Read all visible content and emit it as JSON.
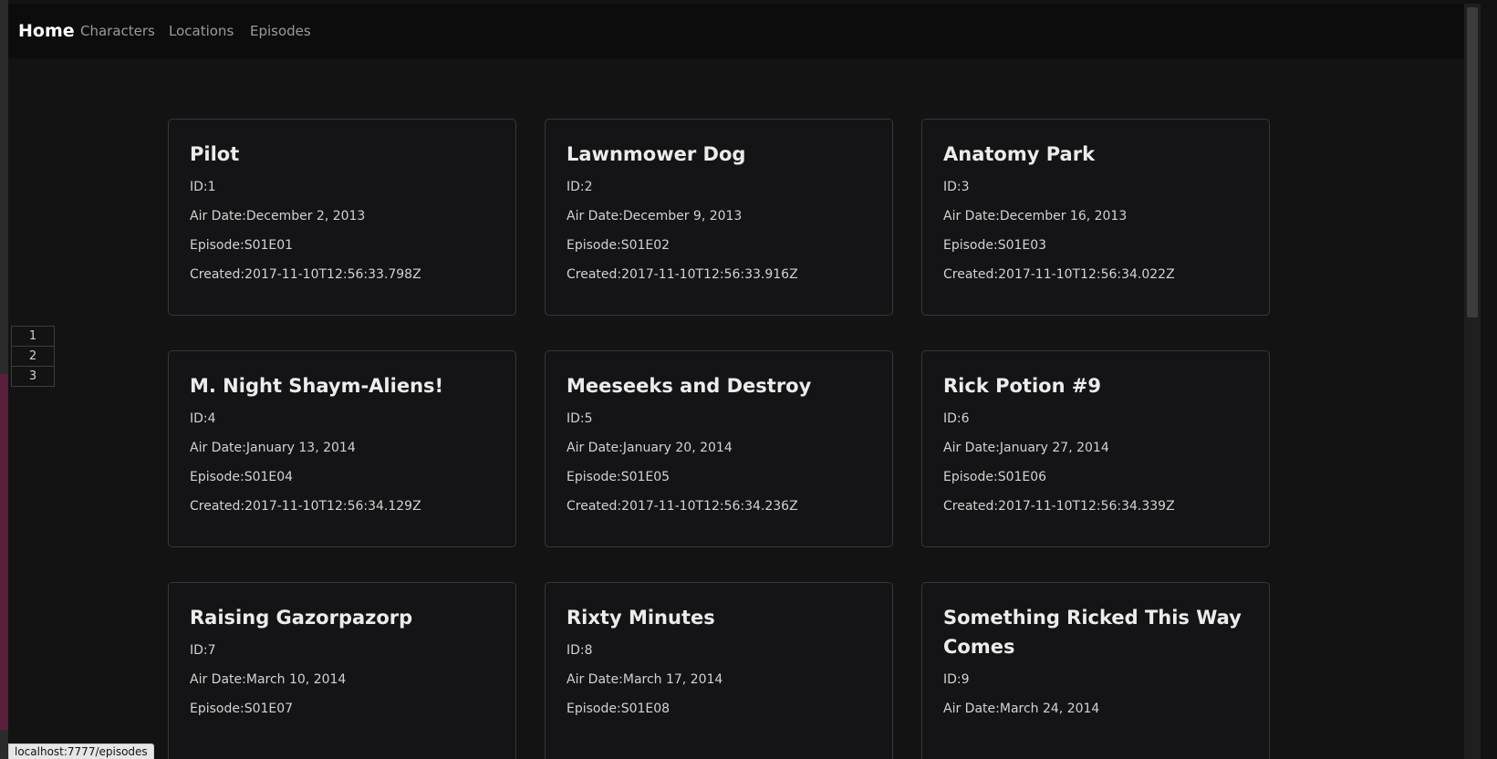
{
  "navbar": {
    "brand": "Home",
    "links": [
      {
        "label": "Characters",
        "active": true
      },
      {
        "label": "Locations",
        "active": false
      },
      {
        "label": "Episodes",
        "active": false
      }
    ]
  },
  "pagination": [
    "1",
    "2",
    "3"
  ],
  "labels": {
    "id": "ID:",
    "air_date": "Air Date:",
    "episode": "Episode:",
    "created": "Created:"
  },
  "episodes": [
    {
      "name": "Pilot",
      "id": "1",
      "air_date": "December 2, 2013",
      "episode": "S01E01",
      "created": "2017-11-10T12:56:33.798Z"
    },
    {
      "name": "Lawnmower Dog",
      "id": "2",
      "air_date": "December 9, 2013",
      "episode": "S01E02",
      "created": "2017-11-10T12:56:33.916Z"
    },
    {
      "name": "Anatomy Park",
      "id": "3",
      "air_date": "December 16, 2013",
      "episode": "S01E03",
      "created": "2017-11-10T12:56:34.022Z"
    },
    {
      "name": "M. Night Shaym-Aliens!",
      "id": "4",
      "air_date": "January 13, 2014",
      "episode": "S01E04",
      "created": "2017-11-10T12:56:34.129Z"
    },
    {
      "name": "Meeseeks and Destroy",
      "id": "5",
      "air_date": "January 20, 2014",
      "episode": "S01E05",
      "created": "2017-11-10T12:56:34.236Z"
    },
    {
      "name": "Rick Potion #9",
      "id": "6",
      "air_date": "January 27, 2014",
      "episode": "S01E06",
      "created": "2017-11-10T12:56:34.339Z"
    },
    {
      "name": "Raising Gazorpazorp",
      "id": "7",
      "air_date": "March 10, 2014",
      "episode": "S01E07"
    },
    {
      "name": "Rixty Minutes",
      "id": "8",
      "air_date": "March 17, 2014",
      "episode": "S01E08"
    },
    {
      "name": "Something Ricked This Way Comes",
      "id": "9",
      "air_date": "March 24, 2014"
    }
  ],
  "status_bar": "localhost:7777/episodes",
  "colors": {
    "background": "#131314",
    "navbar": "#0c0c0c",
    "card_border": "#34363a",
    "text": "#dcdcdc"
  }
}
